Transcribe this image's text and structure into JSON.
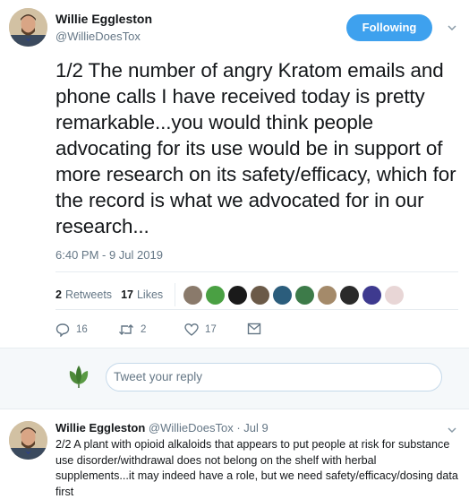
{
  "tweet": {
    "author_name": "Willie Eggleston",
    "author_handle": "@WillieDoesTox",
    "follow_label": "Following",
    "text": "1/2 The number of angry Kratom emails and phone calls I have received today is pretty remarkable...you would think people advocating for its use would be in support of more research on its safety/efficacy, which for the record is what we advocated for in our research...",
    "timestamp": "6:40 PM - 9 Jul 2019",
    "retweets_count": "2",
    "retweets_label": "Retweets",
    "likes_count": "17",
    "likes_label": "Likes",
    "liker_avatar_colors": [
      "#8a7a6b",
      "#4aa043",
      "#1a1a1a",
      "#6b5a48",
      "#2b5d7c",
      "#3d7b49",
      "#a48a6a",
      "#2a2a2a",
      "#3e3a8f",
      "#e8d6d6"
    ],
    "actions": {
      "reply_count": "16",
      "retweet_count": "2",
      "like_count": "17",
      "reply_icon": "reply-icon",
      "retweet_icon": "retweet-icon",
      "like_icon": "heart-icon",
      "dm_icon": "envelope-icon"
    }
  },
  "reply_box": {
    "placeholder": "Tweet your reply"
  },
  "reply": {
    "author_name": "Willie Eggleston",
    "author_handle": "@WillieDoesTox",
    "date": "· Jul 9",
    "text": "2/2 A plant with opioid alkaloids that appears to put people at risk for substance use disorder/withdrawal does not belong on the shelf with herbal supplements...it may indeed have a role, but we need safety/efficacy/dosing data first"
  },
  "colors": {
    "accent": "#3ea1ee",
    "muted": "#657786",
    "text": "#14171a",
    "divider": "#e6ecf0",
    "reply_bg": "#f5f8fa"
  }
}
